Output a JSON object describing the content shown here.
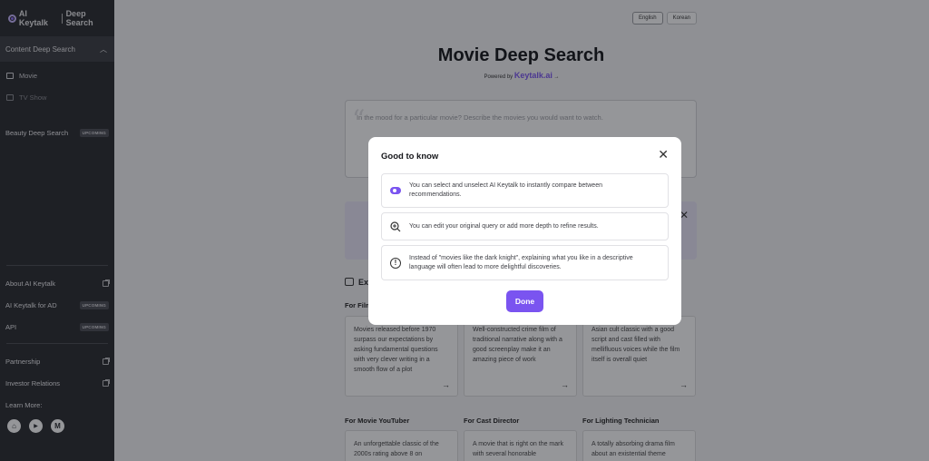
{
  "sidebar": {
    "logo_brand": "AI Keytalk",
    "logo_product": "Deep Search",
    "content_group": "Content Deep Search",
    "items": [
      {
        "label": "Movie"
      },
      {
        "label": "TV Show"
      }
    ],
    "beauty": {
      "label": "Beauty Deep Search",
      "badge": "UPCOMING"
    },
    "links": [
      {
        "label": "About AI Keytalk",
        "icon": "external-link-icon"
      },
      {
        "label": "AI Keytalk for AD",
        "badge": "UPCOMING"
      },
      {
        "label": "API",
        "badge": "UPCOMING"
      }
    ],
    "more_links": [
      {
        "label": "Partnership",
        "icon": "external-link-icon"
      },
      {
        "label": "Investor Relations",
        "icon": "external-link-icon"
      }
    ],
    "learn_more": "Learn More:",
    "social": [
      "home-icon",
      "youtube-icon",
      "medium-icon"
    ],
    "social_glyphs": [
      "⌂",
      "▶",
      "M"
    ]
  },
  "main": {
    "lang": [
      "English",
      "Korean"
    ],
    "title": "Movie Deep Search",
    "powered_by": "Powered by",
    "powered_brand": "Keytalk.ai",
    "query_placeholder": "In the mood for a particular movie? Describe the movies you would want to watch.",
    "examples_label": "Ex",
    "columns": [
      "For Film",
      "For Movie YouTuber",
      "For Cast Director",
      "For Lighting Technician"
    ],
    "cards_row1": [
      "Movies released before 1970 surpass our expectations by asking fundamental questions with very clever writing in a smooth flow of a plot",
      "Well-constructed crime film of traditional narrative along with a good screenplay make it an amazing piece of work",
      "Asian cult classic with a good script and cast filled with mellifluous voices while the film itself is overall quiet"
    ],
    "cards_row2": [
      "An unforgettable classic of the 2000s rating above 8 on",
      "A movie that is right on the mark with several honorable",
      "A totally absorbing drama film about an existential theme"
    ]
  },
  "modal": {
    "title": "Good to know",
    "close_glyph": "✕",
    "tips": [
      {
        "icon": "toggle-icon",
        "text": "You can select and unselect AI Keytalk to instantly compare between recommendations."
      },
      {
        "icon": "zoom-plus-icon",
        "text": "You can edit your original query or add more depth to refine results."
      },
      {
        "icon": "info-icon",
        "text": "Instead of \"movies like the dark knight\", explaining what you like in a descriptive language will often lead to more delightful discoveries."
      }
    ],
    "done_label": "Done"
  },
  "colors": {
    "accent": "#7a54f0",
    "sidebar": "#27282d",
    "overlay": "rgba(20,22,28,0.45)"
  }
}
